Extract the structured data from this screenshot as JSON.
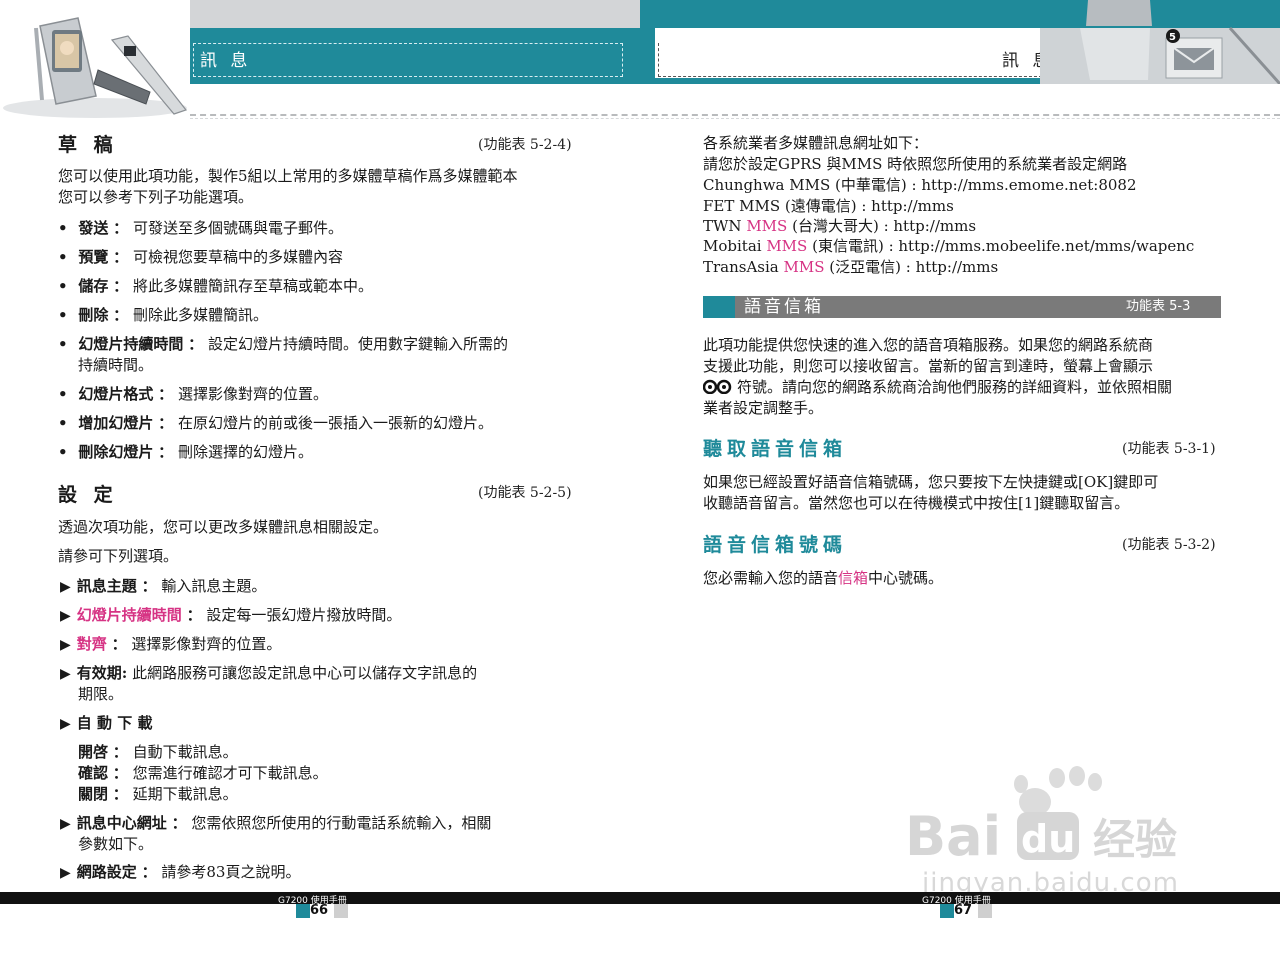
{
  "header": {
    "left_title": "訊 息",
    "right_title": "訊 息",
    "chapter_badge": "5"
  },
  "left": {
    "draft": {
      "title": "草 稿",
      "ref": "(功能表 5-2-4)",
      "intro1": "您可以使用此項功能，製作5組以上常用的多媒體草稿作爲多媒體範本",
      "intro2": "您可以參考下列子功能選項。",
      "items": [
        {
          "label": "發送",
          "sep": "：",
          "text": "可發送至多個號碼與電子郵件。"
        },
        {
          "label": "預覽",
          "sep": "：",
          "text": "可檢視您要草稿中的多媒體內容"
        },
        {
          "label": "儲存",
          "sep": "：",
          "text": "將此多媒體簡訊存至草稿或範本中。"
        },
        {
          "label": "刪除",
          "sep": "：",
          "text": "刪除此多媒體簡訊。"
        },
        {
          "label": "幻燈片持續時間",
          "sep": "：",
          "text": "設定幻燈片持續時間。使用數字鍵輸入所需的",
          "text2": "持續時間。"
        },
        {
          "label": "幻燈片格式",
          "sep": "：",
          "text": "選擇影像對齊的位置。"
        },
        {
          "label": "增加幻燈片",
          "sep": "：",
          "text": "在原幻燈片的前或後一張插入一張新的幻燈片。"
        },
        {
          "label": "刪除幻燈片",
          "sep": "：",
          "text": "刪除選擇的幻燈片。"
        }
      ]
    },
    "settings": {
      "title": "設 定",
      "ref": "(功能表 5-2-5)",
      "intro1": "透過次項功能，您可以更改多媒體訊息相關設定。",
      "intro2": "請參可下列選項。",
      "items": [
        {
          "label": "訊息主題",
          "sep": "：",
          "text": "輸入訊息主題。"
        },
        {
          "label": "幻燈片持續時間",
          "sep": "：",
          "text": "設定每一張幻燈片撥放時間。"
        },
        {
          "label": "對齊",
          "sep": "：",
          "text": "選擇影像對齊的位置。"
        },
        {
          "label": "有效期:",
          "sep": "",
          "text": "此網路服務可讓您設定訊息中心可以儲存文字訊息的",
          "text2": "期限。"
        },
        {
          "label": "自 動 下 載",
          "sep": "",
          "text": ""
        },
        {
          "label": "訊息中心網址",
          "sep": "：",
          "text": "您需依照您所使用的行動電話系統輸入，相關",
          "text2": "參數如下。"
        },
        {
          "label": "網路設定",
          "sep": "：",
          "text": "請參考83頁之說明。"
        }
      ],
      "autodl": [
        {
          "label": "開啓",
          "sep": "：",
          "text": "自動下載訊息。"
        },
        {
          "label": "確認",
          "sep": "：",
          "text": "您需進行確認才可下載訊息。"
        },
        {
          "label": "關閉",
          "sep": "：",
          "text": "延期下載訊息。"
        }
      ]
    },
    "footer": {
      "manual": "G7200 使用手冊",
      "page": "66"
    }
  },
  "right": {
    "mms_urls": {
      "line1": "各系統業者多媒體訊息網址如下：",
      "line2": "請您於設定GPRS 與MMS 時依照您所使用的系統業者設定網路",
      "rows": [
        {
          "pre": "Chunghwa MMS (中華電信) : http://mms.emome.net:8082",
          "mms": "",
          "post": ""
        },
        {
          "pre": "FET MMS (遠傳電信) : http://mms",
          "mms": "",
          "post": ""
        },
        {
          "pre": "TWN ",
          "mms": "MMS",
          "post": " (台灣大哥大) : http://mms"
        },
        {
          "pre": "Mobitai ",
          "mms": "MMS",
          "post": " (東信電訊) : http://mms.mobeelife.net/mms/wapenc"
        },
        {
          "pre": "TransAsia ",
          "mms": "MMS",
          "post": " (泛亞電信) : http://mms"
        }
      ]
    },
    "voicemail": {
      "bar_title": "語音信箱",
      "bar_ref": "功能表  5-3",
      "intro": [
        "此項功能提供您快速的進入您的語音項箱服務。如果您的網路系統商",
        "支援此功能，則您可以接收留言。當新的留言到達時，螢幕上會顯示",
        "符號。請向您的網路系統商洽詢他們服務的詳細資料，並依照相關",
        "業者設定調整手。"
      ]
    },
    "listen": {
      "title": "聽取語音信箱",
      "ref": "(功能表 5-3-1)",
      "lines": [
        "如果您已經設置好語音信箱號碼，您只要按下左快捷鍵或[OK]鍵即可",
        "收聽語音留言。當然您也可以在待機模式中按住[1]鍵聽取留言。"
      ]
    },
    "number": {
      "title": "語音信箱號碼",
      "ref": "(功能表 5-3-2)",
      "pre": "您必需輸入您的語音",
      "pink": "信箱",
      "post": "中心號碼。"
    },
    "footer": {
      "manual": "G7200 使用手冊",
      "page": "67"
    }
  },
  "watermark": {
    "brand": "Bai",
    "brand2": "du",
    "cn": "经验",
    "url": "jingyan.baidu.com"
  },
  "colors": {
    "teal": "#1f8a9a",
    "pink": "#d63384",
    "gray_bar": "#7a7a7a"
  }
}
